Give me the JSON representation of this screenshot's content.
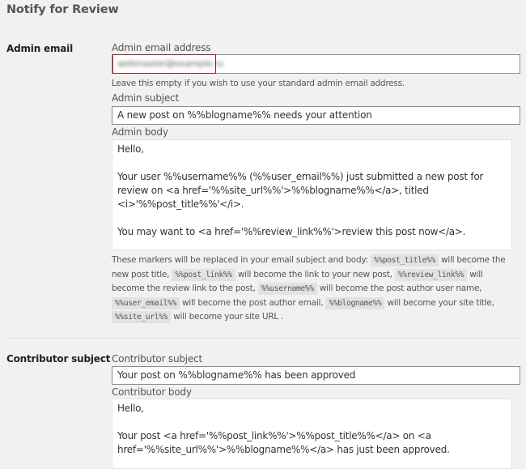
{
  "page": {
    "title": "Notify for Review"
  },
  "admin": {
    "row_label": "Admin email",
    "email_label": "Admin email address",
    "email_value": "webmaster@example.ru",
    "email_help": "Leave this empty if you wish to use your standard admin email address.",
    "subject_label": "Admin subject",
    "subject_value": "A new post on %%blogname%% needs your attention",
    "body_label": "Admin body",
    "body_value": "Hello,\n\nYour user %%username%% (%%user_email%%) just submitted a new post for review on <a href='%%site_url%%'>%%blogname%%</a>, titled <i>'%%post_title%%'</i>.\n\nYou may want to <a href='%%review_link%%'>review this post now</a>."
  },
  "markers": {
    "intro": "These markers will be replaced in your email subject and body:",
    "items": [
      {
        "code": "%%post_title%%",
        "text": "will become the new post title,"
      },
      {
        "code": "%%post_link%%",
        "text": "will become the link to your new post,"
      },
      {
        "code": "%%review_link%%",
        "text": "will become the review link to the post,"
      },
      {
        "code": "%%username%%",
        "text": "will become the post author user name,"
      },
      {
        "code": "%%user_email%%",
        "text": "will become the post author email,"
      },
      {
        "code": "%%blogname%%",
        "text": "will become your site title,"
      },
      {
        "code": "%%site_url%%",
        "text": "will become your site URL ."
      }
    ]
  },
  "contributor": {
    "row_label": "Contributor subject",
    "subject_label": "Contributor subject",
    "subject_value": "Your post on %%blogname%% has been approved",
    "body_label": "Contributor body",
    "body_value": "Hello,\n\nYour post <a href='%%post_link%%'>%%post_title%%</a> on <a href='%%site_url%%'>%%blogname%%</a> has just been approved."
  },
  "colors": {
    "background": "#f1f1f1",
    "focus_highlight": "#9b1c1c"
  }
}
